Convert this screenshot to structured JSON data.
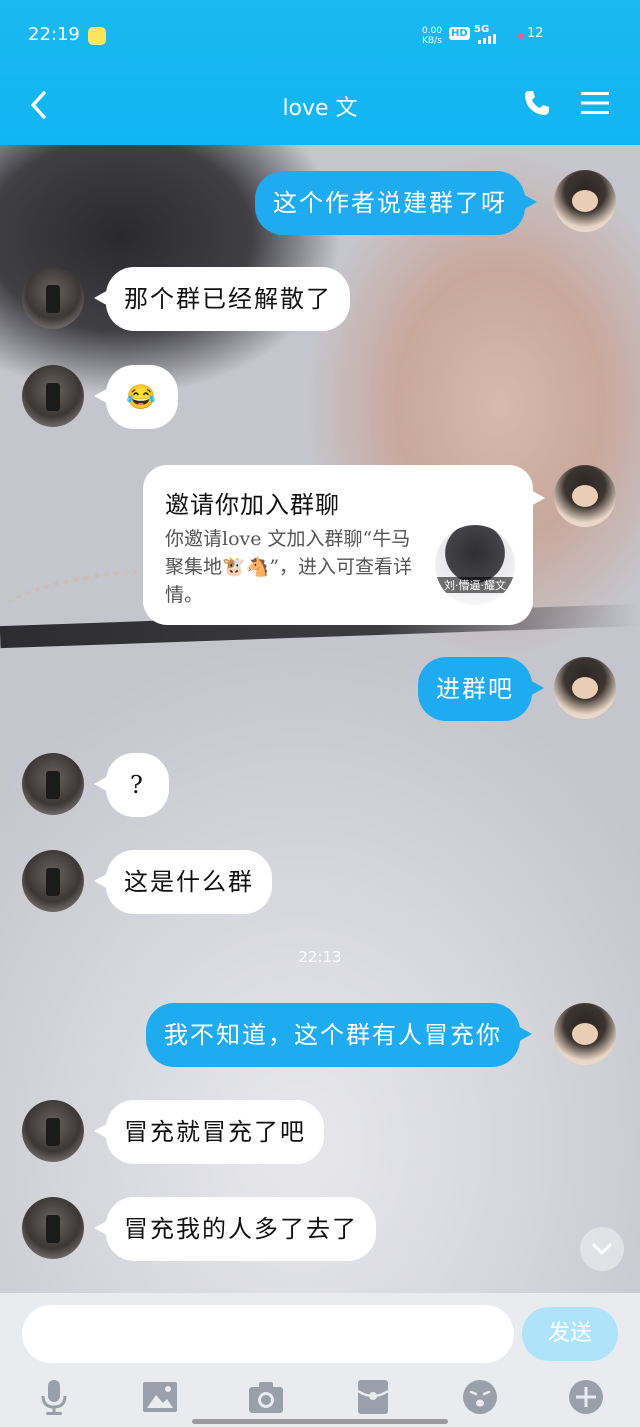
{
  "status_bar": {
    "time": "22:19",
    "net_speed": "0.00",
    "net_unit": "KB/s",
    "hd": "HD",
    "network": "5G",
    "battery": "12"
  },
  "header": {
    "title": "love  文"
  },
  "messages": [
    {
      "side": "right",
      "text": "这个作者说建群了呀"
    },
    {
      "side": "left",
      "text": "那个群已经解散了"
    },
    {
      "side": "left",
      "text": "😂"
    },
    {
      "side": "right",
      "text": "进群吧"
    },
    {
      "side": "left",
      "text": "?"
    },
    {
      "side": "left",
      "text": "这是什么群"
    },
    {
      "side": "right",
      "text": "我不知道，这个群有人冒充你"
    },
    {
      "side": "left",
      "text": "冒充就冒充了吧"
    },
    {
      "side": "left",
      "text": "冒充我的人多了去了"
    }
  ],
  "invite_card": {
    "title": "邀请你加入群聊",
    "description": "你邀请love  文加入群聊“牛马聚集地🐮🐴”，进入可查看详情。",
    "thumb_label": "刘·懵逼·耀文"
  },
  "timestamp": "22:13",
  "composer": {
    "send_label": "发送"
  },
  "colors": {
    "accent": "#12b5f3",
    "bubble_sent": "#1eabf0",
    "bubble_received": "#ffffff",
    "send_disabled": "#aee3f9"
  }
}
